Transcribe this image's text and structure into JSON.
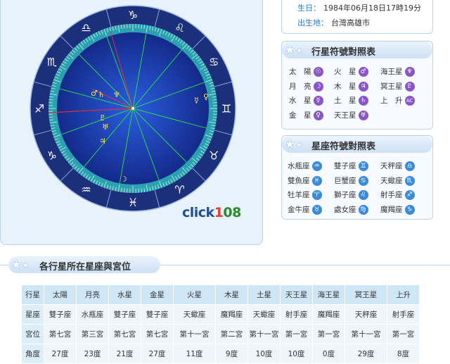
{
  "birth": {
    "date_label": "生日：",
    "date_value": "1984年06月18日17時19分",
    "place_label": "出生地：",
    "place_value": "台灣高雄市"
  },
  "brand": {
    "text_a": "click",
    "text_b": "1",
    "text_c": "08"
  },
  "planet_legend": {
    "title": "行星符號對照表",
    "items": [
      {
        "name": "太　陽",
        "glyph": "☉",
        "color": "#8a55c8"
      },
      {
        "name": "火　星",
        "glyph": "♂",
        "color": "#8a55c8"
      },
      {
        "name": "海王星",
        "glyph": "♆",
        "color": "#8a55c8"
      },
      {
        "name": "月　亮",
        "glyph": "☽",
        "color": "#8a55c8"
      },
      {
        "name": "木　星",
        "glyph": "♃",
        "color": "#8a55c8"
      },
      {
        "name": "冥王星",
        "glyph": "♇",
        "color": "#8a55c8"
      },
      {
        "name": "水　星",
        "glyph": "☿",
        "color": "#8a55c8"
      },
      {
        "name": "土　星",
        "glyph": "♄",
        "color": "#8a55c8"
      },
      {
        "name": "上　升",
        "glyph": "AC",
        "color": "#8a55c8"
      },
      {
        "name": "金　星",
        "glyph": "♀",
        "color": "#8a55c8"
      },
      {
        "name": "天王星",
        "glyph": "♅",
        "color": "#8a55c8"
      }
    ]
  },
  "sign_legend": {
    "title": "星座符號對照表",
    "items": [
      {
        "name": "水瓶座",
        "glyph": "♒",
        "color": "#3a8ad8"
      },
      {
        "name": "雙子座",
        "glyph": "♊",
        "color": "#3a8ad8"
      },
      {
        "name": "天秤座",
        "glyph": "♎",
        "color": "#3a8ad8"
      },
      {
        "name": "雙魚座",
        "glyph": "♓",
        "color": "#3a8ad8"
      },
      {
        "name": "巨蟹座",
        "glyph": "♋",
        "color": "#3a8ad8"
      },
      {
        "name": "天蠍座",
        "glyph": "♏",
        "color": "#3a8ad8"
      },
      {
        "name": "牡羊座",
        "glyph": "♈",
        "color": "#3a8ad8"
      },
      {
        "name": "獅子座",
        "glyph": "♌",
        "color": "#3a8ad8"
      },
      {
        "name": "射手座",
        "glyph": "♐",
        "color": "#3a8ad8"
      },
      {
        "name": "金牛座",
        "glyph": "♉",
        "color": "#3a8ad8"
      },
      {
        "name": "處女座",
        "glyph": "♍",
        "color": "#3a8ad8"
      },
      {
        "name": "魔羯座",
        "glyph": "♑",
        "color": "#3a8ad8"
      }
    ]
  },
  "wheel": {
    "signs": [
      "♑",
      "♌",
      "♋",
      "♊",
      "♉",
      "♈",
      "♓",
      "♒",
      "♑",
      "♐",
      "♏",
      "♎"
    ],
    "ring_color": "#1c2f7a",
    "inner_color": "#1a3fb0",
    "tick_ring_color": "#2aa0b0",
    "house_line_color": "#2bd44a",
    "axis_line_color": "#e0303a"
  },
  "table": {
    "title": "各行星所在星座與宮位",
    "columns": [
      "行星",
      "太陽",
      "月亮",
      "水星",
      "金星",
      "火星",
      "木星",
      "土星",
      "天王星",
      "海王星",
      "冥王星",
      "上升"
    ],
    "rows": [
      {
        "label": "星座",
        "values": [
          "雙子座",
          "水瓶座",
          "雙子座",
          "雙子座",
          "天蠍座",
          "魔羯座",
          "天蠍座",
          "射手座",
          "魔羯座",
          "天秤座",
          "射手座"
        ]
      },
      {
        "label": "宮位",
        "values": [
          "第七宮",
          "第三宮",
          "第七宮",
          "第七宮",
          "第十一宮",
          "第二宮",
          "第十一宮",
          "第一宮",
          "第一宮",
          "第十一宮",
          "第一宮"
        ]
      },
      {
        "label": "角度",
        "values": [
          "27度",
          "23度",
          "21度",
          "27度",
          "11度",
          "9度",
          "10度",
          "10度",
          "0度",
          "29度",
          "8度"
        ]
      }
    ]
  }
}
